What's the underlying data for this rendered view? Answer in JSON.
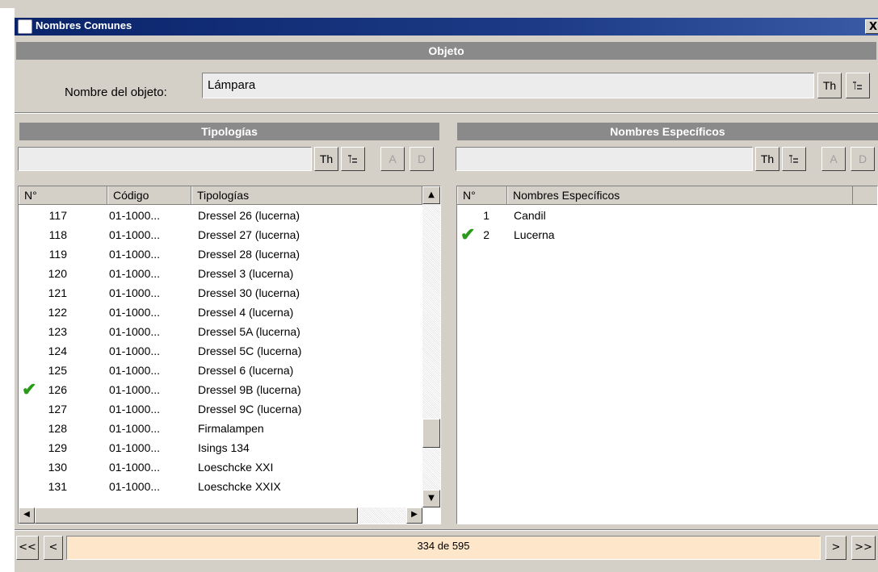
{
  "window": {
    "title": "Nombres Comunes",
    "close": "X"
  },
  "objeto": {
    "header": "Objeto",
    "label": "Nombre del objeto:",
    "value": "Lámpara",
    "th_label": "Th"
  },
  "tipologias": {
    "header": "Tipologías",
    "search_value": "",
    "buttons": {
      "th": "Th",
      "a": "A",
      "d": "D"
    },
    "columns": [
      "N°",
      "Código",
      "Tipologías"
    ],
    "rows": [
      {
        "n": "117",
        "code": "01-1000...",
        "name": "Dressel 26 (lucerna)",
        "checked": false
      },
      {
        "n": "118",
        "code": "01-1000...",
        "name": "Dressel 27 (lucerna)",
        "checked": false
      },
      {
        "n": "119",
        "code": "01-1000...",
        "name": "Dressel 28 (lucerna)",
        "checked": false
      },
      {
        "n": "120",
        "code": "01-1000...",
        "name": "Dressel 3 (lucerna)",
        "checked": false
      },
      {
        "n": "121",
        "code": "01-1000...",
        "name": "Dressel 30 (lucerna)",
        "checked": false
      },
      {
        "n": "122",
        "code": "01-1000...",
        "name": "Dressel 4 (lucerna)",
        "checked": false
      },
      {
        "n": "123",
        "code": "01-1000...",
        "name": "Dressel 5A (lucerna)",
        "checked": false
      },
      {
        "n": "124",
        "code": "01-1000...",
        "name": "Dressel 5C (lucerna)",
        "checked": false
      },
      {
        "n": "125",
        "code": "01-1000...",
        "name": "Dressel 6 (lucerna)",
        "checked": false
      },
      {
        "n": "126",
        "code": "01-1000...",
        "name": "Dressel 9B (lucerna)",
        "checked": true
      },
      {
        "n": "127",
        "code": "01-1000...",
        "name": "Dressel 9C (lucerna)",
        "checked": false
      },
      {
        "n": "128",
        "code": "01-1000...",
        "name": "Firmalampen",
        "checked": false
      },
      {
        "n": "129",
        "code": "01-1000...",
        "name": "Isings 134",
        "checked": false
      },
      {
        "n": "130",
        "code": "01-1000...",
        "name": "Loeschcke XXI",
        "checked": false
      },
      {
        "n": "131",
        "code": "01-1000...",
        "name": "Loeschcke XXIX",
        "checked": false
      }
    ]
  },
  "especificos": {
    "header": "Nombres Específicos",
    "search_value": "",
    "buttons": {
      "th": "Th",
      "a": "A",
      "d": "D"
    },
    "columns": [
      "N°",
      "Nombres Específicos"
    ],
    "rows": [
      {
        "n": "1",
        "name": "Candil",
        "checked": false
      },
      {
        "n": "2",
        "name": "Lucerna",
        "checked": true
      }
    ]
  },
  "footer": {
    "first": "<<",
    "prev": "<",
    "status": "334 de 595",
    "next": ">",
    "last": ">>"
  },
  "icons": {
    "check": "check-icon",
    "tree": "tree-icon"
  },
  "colors": {
    "titlebar": "#0a246a",
    "section": "#8a8a8a",
    "status_bg": "#fde6c9",
    "check": "#2a9a1a"
  }
}
